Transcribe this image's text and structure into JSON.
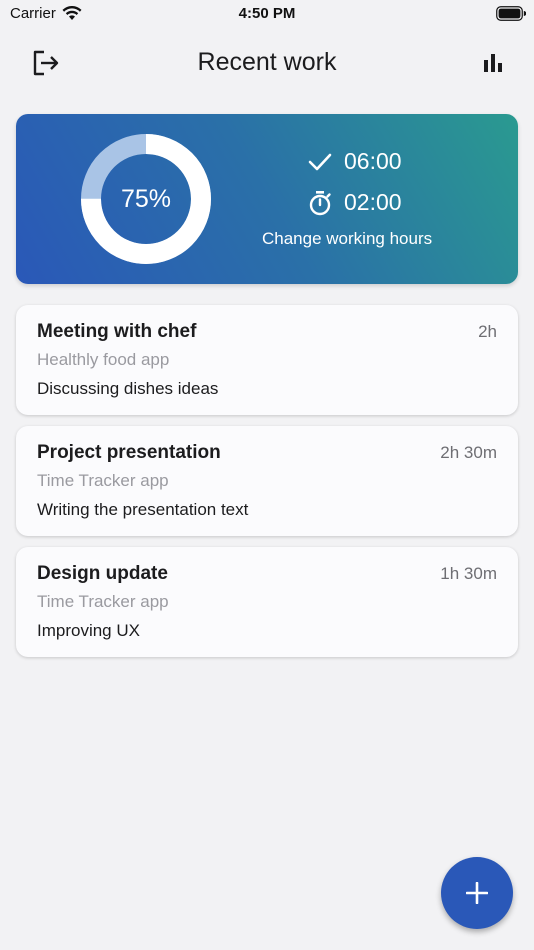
{
  "status_bar": {
    "carrier": "Carrier",
    "time": "4:50 PM",
    "icons": [
      "wifi-icon",
      "battery-icon"
    ]
  },
  "header": {
    "title": "Recent work",
    "left_icon": "logout-icon",
    "right_icon": "bar-chart-icon"
  },
  "summary": {
    "progress_label": "75%",
    "progress_value": 0.75,
    "done_hours": "06:00",
    "remaining_hours": "02:00",
    "change_hours_label": "Change working hours",
    "icons": [
      "check-icon",
      "stopwatch-icon"
    ],
    "gradient_colors": [
      "#2a58b8",
      "#2a9a90"
    ]
  },
  "work_items": [
    {
      "title": "Meeting with chef",
      "duration": "2h",
      "project": "Healthly food app",
      "description": "Discussing dishes ideas"
    },
    {
      "title": "Project presentation",
      "duration": "2h 30m",
      "project": "Time Tracker app",
      "description": "Writing the presentation text"
    },
    {
      "title": "Design update",
      "duration": "1h 30m",
      "project": "Time Tracker app",
      "description": "Improving UX"
    }
  ],
  "fab": {
    "icon": "plus-icon",
    "color": "#2a58b8"
  }
}
